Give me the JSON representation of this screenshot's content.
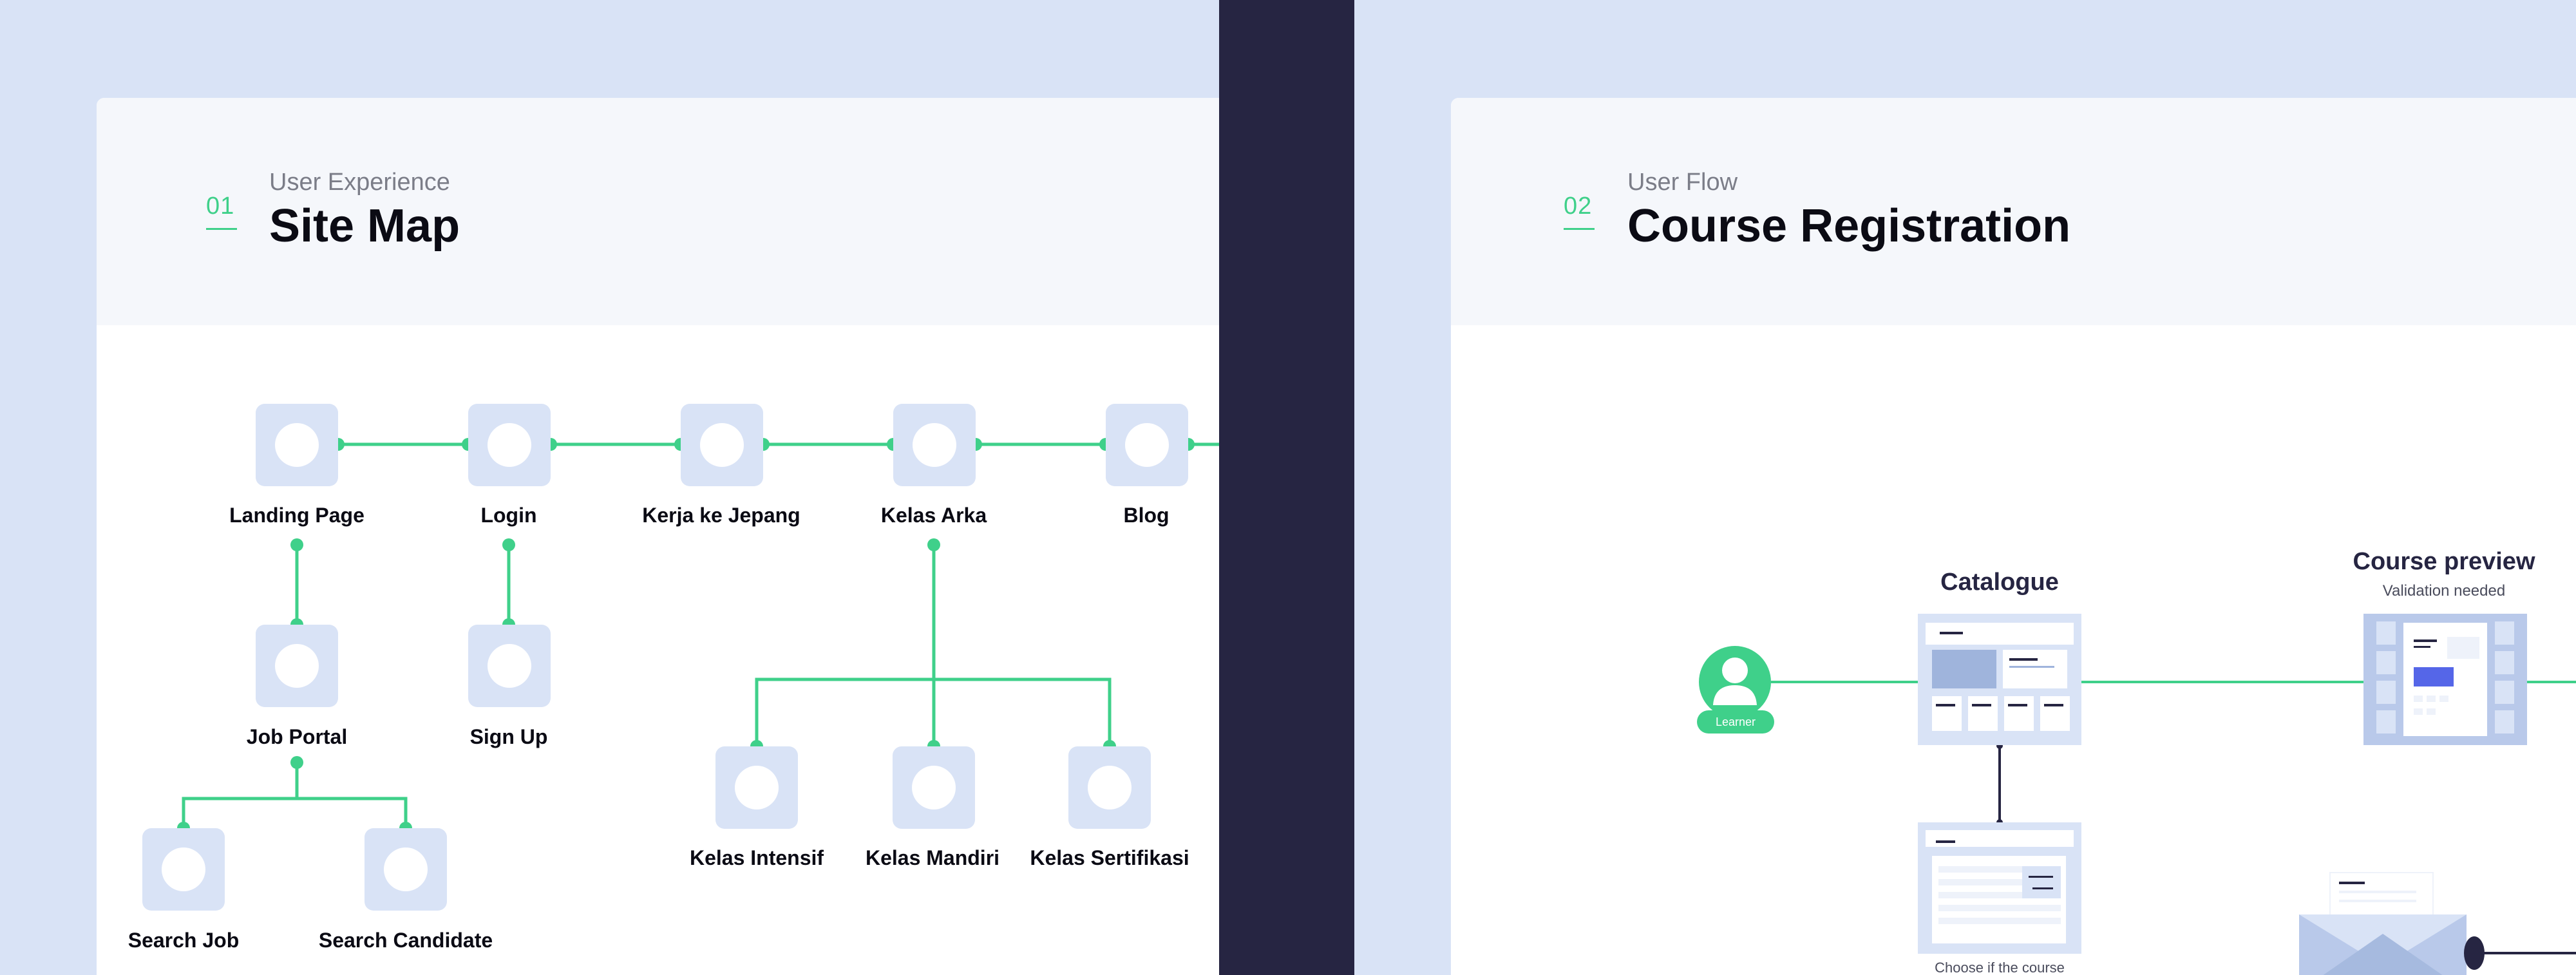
{
  "panel1": {
    "number": "01",
    "subtitle": "User Experience",
    "title": "Site Map",
    "nodes": {
      "landing": "Landing Page",
      "login": "Login",
      "kerja": "Kerja ke Jepang",
      "kelas_arka": "Kelas Arka",
      "blog": "Blog",
      "job_portal": "Job Portal",
      "sign_up": "Sign Up",
      "search_job": "Search Job",
      "search_candidate": "Search Candidate",
      "kelas_intensif": "Kelas Intensif",
      "kelas_mandiri": "Kelas Mandiri",
      "kelas_sertifikasi": "Kelas Sertifikasi"
    }
  },
  "panel2": {
    "number": "02",
    "subtitle": "User Flow",
    "title": "Course Registration",
    "learner_label": "Learner",
    "catalogue_label": "Catalogue",
    "course_preview_label": "Course preview",
    "validation_label": "Validation needed",
    "choose_label": "Choose if the course"
  },
  "colors": {
    "accent": "#3fd08a",
    "node_fill": "#d9e3f6",
    "background": "#262542"
  }
}
